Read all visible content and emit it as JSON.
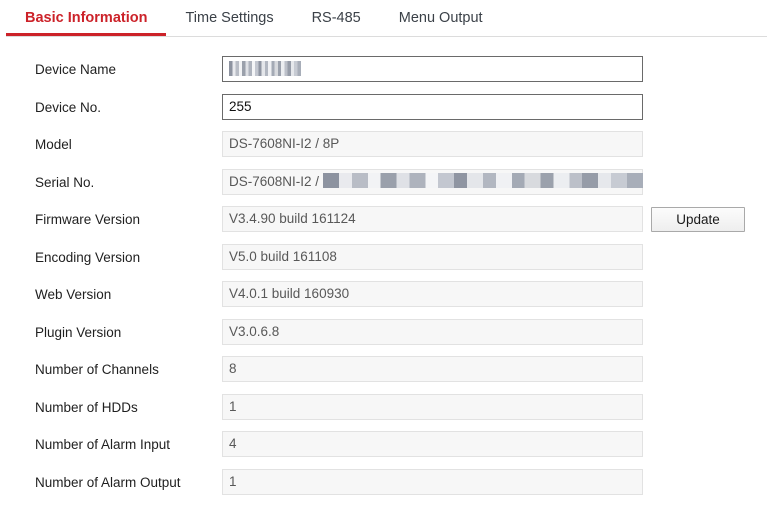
{
  "tabs": [
    {
      "label": "Basic Information",
      "active": true
    },
    {
      "label": "Time Settings",
      "active": false
    },
    {
      "label": "RS-485",
      "active": false
    },
    {
      "label": "Menu Output",
      "active": false
    }
  ],
  "colors": {
    "accent_red": "#cc2229",
    "tab_inactive": "#3b4148",
    "readonly_bg": "#f7f7f7",
    "readonly_border": "#e2e2e2",
    "edit_border": "#6a6a6a"
  },
  "form": {
    "fields": [
      {
        "label": "Device Name",
        "value": "",
        "editable": true,
        "redacted": "dn"
      },
      {
        "label": "Device No.",
        "value": "255",
        "editable": true,
        "redacted": ""
      },
      {
        "label": "Model",
        "value": "DS-7608NI-I2 / 8P",
        "editable": false,
        "redacted": ""
      },
      {
        "label": "Serial No.",
        "value": "DS-7608NI-I2 / ",
        "editable": false,
        "redacted": "sn"
      },
      {
        "label": "Firmware Version",
        "value": "V3.4.90 build 161124",
        "editable": false,
        "redacted": ""
      },
      {
        "label": "Encoding Version",
        "value": "V5.0 build 161108",
        "editable": false,
        "redacted": ""
      },
      {
        "label": "Web Version",
        "value": "V4.0.1 build 160930",
        "editable": false,
        "redacted": ""
      },
      {
        "label": "Plugin Version",
        "value": "V3.0.6.8",
        "editable": false,
        "redacted": ""
      },
      {
        "label": "Number of Channels",
        "value": "8",
        "editable": false,
        "redacted": ""
      },
      {
        "label": "Number of HDDs",
        "value": "1",
        "editable": false,
        "redacted": ""
      },
      {
        "label": "Number of Alarm Input",
        "value": "4",
        "editable": false,
        "redacted": ""
      },
      {
        "label": "Number of Alarm Output",
        "value": "1",
        "editable": false,
        "redacted": ""
      }
    ],
    "update_button": {
      "label": "Update",
      "row_index": 4
    }
  }
}
